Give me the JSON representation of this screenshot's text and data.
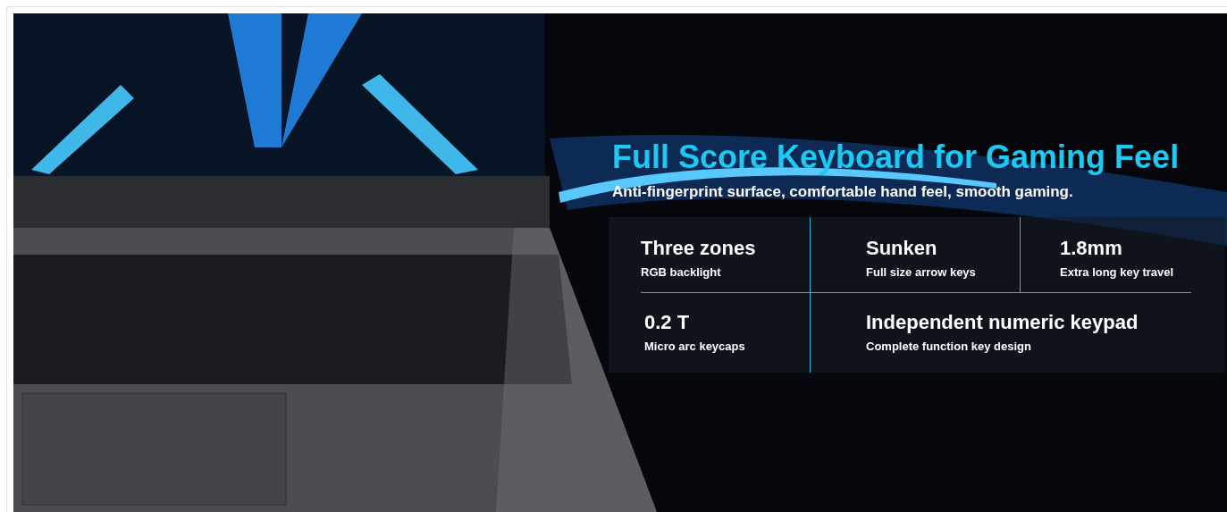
{
  "banner": {
    "kind": "picture",
    "heading": "Full Score Keyboard for Gaming Feel",
    "subheading": "Anti-fingerprint surface, comfortable hand feel, smooth gaming.",
    "specs": [
      {
        "title": "Three zones",
        "caption": "RGB backlight"
      },
      {
        "title": "Sunken",
        "caption": "Full size arrow keys"
      },
      {
        "title": "1.8mm",
        "caption": "Extra long key travel"
      },
      {
        "title": "0.2 T",
        "caption": "Micro arc keycaps"
      },
      {
        "title": "Independent numeric keypad",
        "caption": "Complete function key design"
      }
    ]
  }
}
